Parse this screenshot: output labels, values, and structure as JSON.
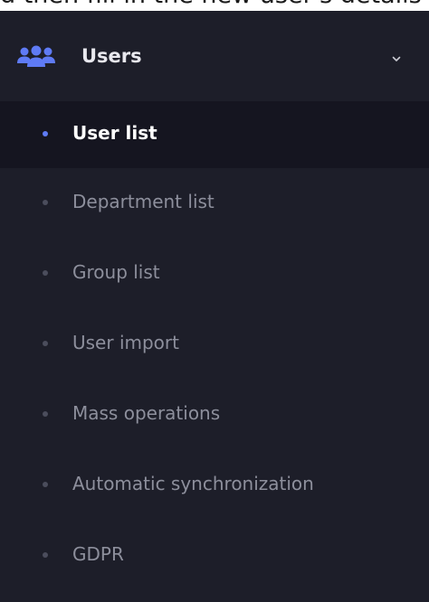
{
  "caption": "d then fill in the new user's details",
  "menu": {
    "header": {
      "label": "Users",
      "icon": "users-icon",
      "accent_color": "#5f7bf5",
      "expanded": true
    },
    "items": [
      {
        "label": "User list",
        "active": true
      },
      {
        "label": "Department list",
        "active": false
      },
      {
        "label": "Group list",
        "active": false
      },
      {
        "label": "User import",
        "active": false
      },
      {
        "label": "Mass operations",
        "active": false
      },
      {
        "label": "Automatic synchronization",
        "active": false
      },
      {
        "label": "GDPR",
        "active": false
      }
    ]
  },
  "colors": {
    "sidebar_bg": "#1d1e29",
    "active_bg": "#151520",
    "active_text": "#ffffff",
    "inactive_text": "#8d8f9c",
    "accent": "#5f7bf5"
  }
}
